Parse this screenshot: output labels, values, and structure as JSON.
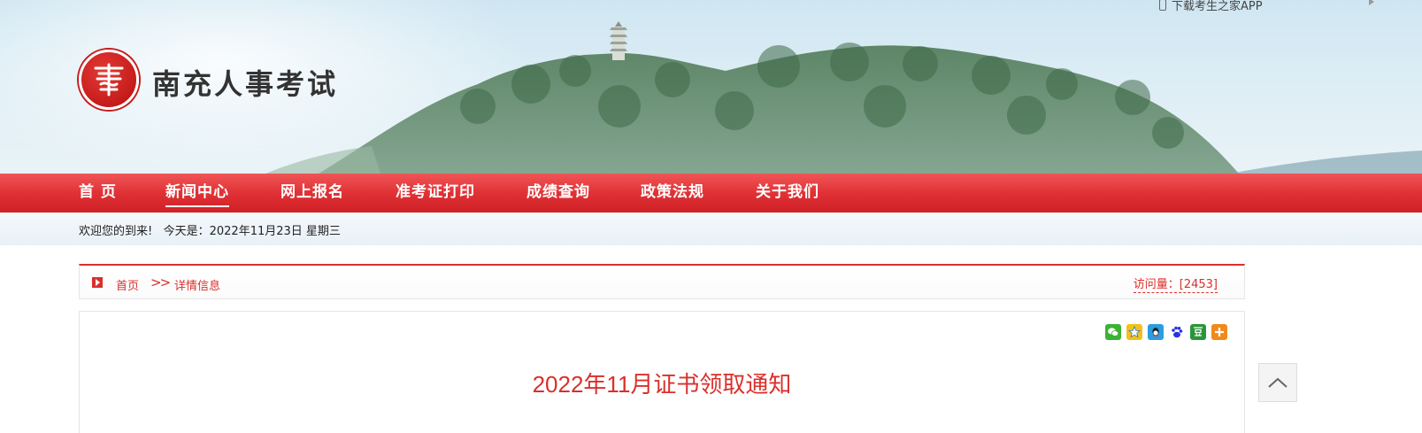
{
  "header": {
    "site_title": "南充人事考试",
    "app_link": "下载考生之家APP",
    "logo_icon": "seal-logo-icon"
  },
  "nav": {
    "items": [
      {
        "label": "首 页",
        "active": false
      },
      {
        "label": "新闻中心",
        "active": true
      },
      {
        "label": "网上报名",
        "active": false
      },
      {
        "label": "准考证打印",
        "active": false
      },
      {
        "label": "成绩查询",
        "active": false
      },
      {
        "label": "政策法规",
        "active": false
      },
      {
        "label": "关于我们",
        "active": false
      }
    ]
  },
  "welcome": {
    "text": "欢迎您的到来!   今天是：2022年11月23日 星期三"
  },
  "breadcrumb": {
    "home": "首页",
    "separator": ">>",
    "current": "详情信息",
    "visits": "访问量：[2453]"
  },
  "share": {
    "icons": [
      "wechat-icon",
      "qzone-icon",
      "qq-icon",
      "baidu-icon",
      "douban-icon",
      "more-icon"
    ]
  },
  "article": {
    "title": "2022年11月证书领取通知"
  },
  "colors": {
    "brand_red": "#d9302c",
    "nav_red": "#e03236"
  }
}
